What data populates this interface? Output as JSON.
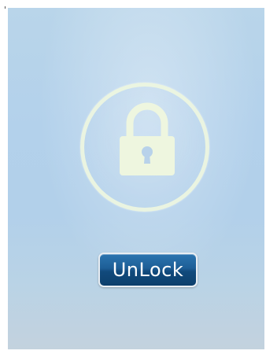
{
  "lock_screen": {
    "icon": "lock-icon",
    "unlock_label": "UnLock"
  },
  "colors": {
    "background_top": "#b9d5ea",
    "background_bottom": "#c3d2de",
    "ring": "#eef6df",
    "lock_body": "#eef6df",
    "keyhole": "#b8d2ea",
    "button_top": "#2c75b0",
    "button_bottom": "#0d3f6c",
    "button_text": "#ffffff"
  }
}
